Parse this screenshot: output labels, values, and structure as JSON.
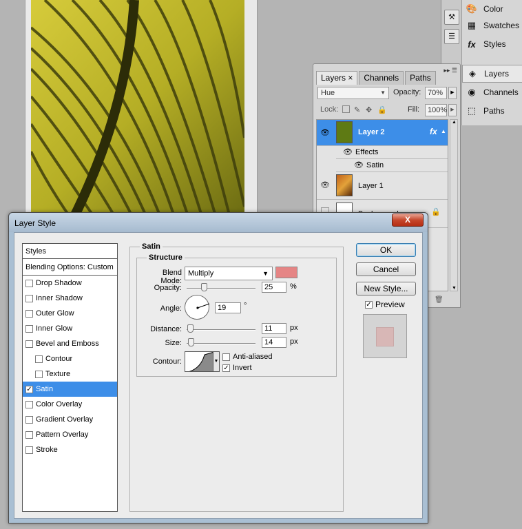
{
  "dock": {
    "items": [
      {
        "label": "Color",
        "icon": "color-icon"
      },
      {
        "label": "Swatches",
        "icon": "swatches-icon"
      },
      {
        "label": "Styles",
        "icon": "styles-icon"
      },
      {
        "label": "Layers",
        "icon": "layers-icon"
      },
      {
        "label": "Channels",
        "icon": "channels-icon"
      },
      {
        "label": "Paths",
        "icon": "paths-icon"
      }
    ]
  },
  "layers_panel": {
    "tabs": [
      "Layers",
      "Channels",
      "Paths"
    ],
    "tab_close": "×",
    "blend_mode": "Hue",
    "opacity_label": "Opacity:",
    "opacity_value": "70%",
    "lock_label": "Lock:",
    "fill_label": "Fill:",
    "fill_value": "100%",
    "layers": [
      {
        "name": "Layer 2",
        "fx": "fx",
        "selected": true
      },
      {
        "name": "Layer 1"
      },
      {
        "name": "Background"
      }
    ],
    "effects_label": "Effects",
    "effect_item": "Satin"
  },
  "dialog": {
    "title": "Layer Style",
    "close_label": "X",
    "styles_header": "Styles",
    "blending_options": "Blending Options: Custom",
    "style_items": [
      {
        "label": "Drop Shadow",
        "checked": false,
        "indent": false
      },
      {
        "label": "Inner Shadow",
        "checked": false,
        "indent": false
      },
      {
        "label": "Outer Glow",
        "checked": false,
        "indent": false
      },
      {
        "label": "Inner Glow",
        "checked": false,
        "indent": false
      },
      {
        "label": "Bevel and Emboss",
        "checked": false,
        "indent": false
      },
      {
        "label": "Contour",
        "checked": false,
        "indent": true
      },
      {
        "label": "Texture",
        "checked": false,
        "indent": true
      },
      {
        "label": "Satin",
        "checked": true,
        "indent": false,
        "selected": true
      },
      {
        "label": "Color Overlay",
        "checked": false,
        "indent": false
      },
      {
        "label": "Gradient Overlay",
        "checked": false,
        "indent": false
      },
      {
        "label": "Pattern Overlay",
        "checked": false,
        "indent": false
      },
      {
        "label": "Stroke",
        "checked": false,
        "indent": false
      }
    ],
    "satin": {
      "section_title": "Satin",
      "structure_title": "Structure",
      "blend_mode_label": "Blend Mode:",
      "blend_mode_value": "Multiply",
      "satin_color": "#e58585",
      "opacity_label": "Opacity:",
      "opacity_value": "25",
      "opacity_unit": "%",
      "opacity_fraction": 0.25,
      "angle_label": "Angle:",
      "angle_value": "19",
      "angle_unit": "°",
      "distance_label": "Distance:",
      "distance_value": "11",
      "distance_unit": "px",
      "distance_fraction": 0.05,
      "size_label": "Size:",
      "size_value": "14",
      "size_unit": "px",
      "size_fraction": 0.06,
      "contour_label": "Contour:",
      "anti_aliased_label": "Anti-aliased",
      "anti_aliased": false,
      "invert_label": "Invert",
      "invert": true
    },
    "buttons": {
      "ok": "OK",
      "cancel": "Cancel",
      "new_style": "New Style...",
      "preview_label": "Preview",
      "preview_checked": true
    }
  }
}
